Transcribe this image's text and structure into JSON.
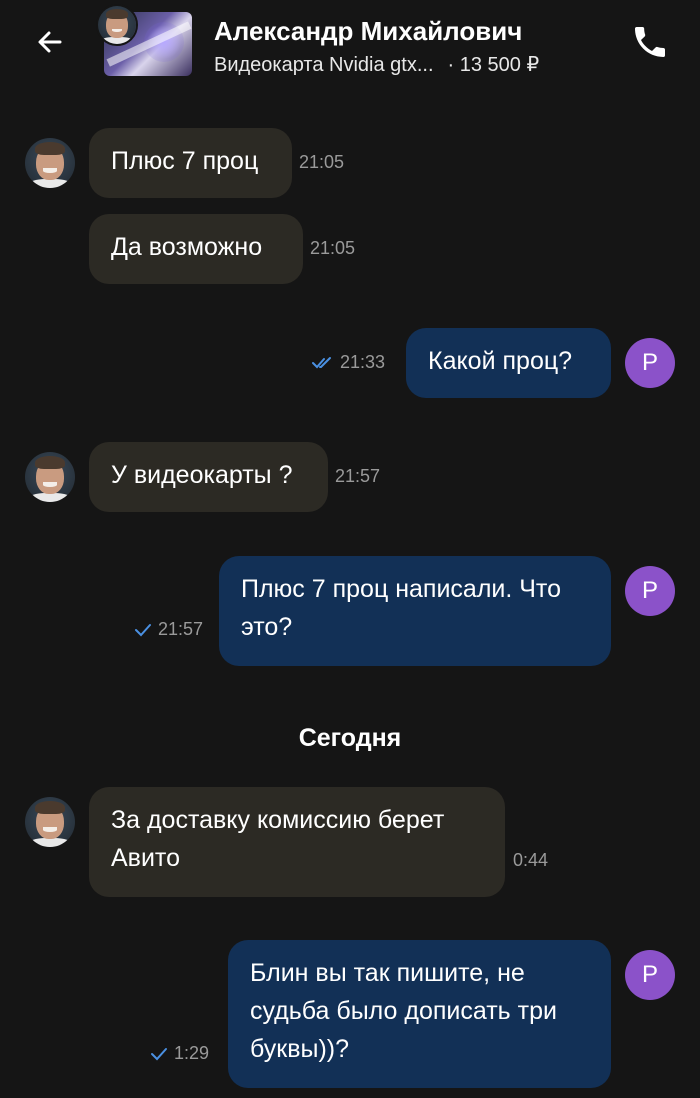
{
  "header": {
    "title": "Александр Михайлович",
    "ad_title": "Видеокарта Nvidia gtx...",
    "price": "· 13 500 ₽",
    "back_icon": "arrow-left-icon",
    "call_icon": "phone-icon"
  },
  "me": {
    "initial": "Р",
    "avatar_color": "#8b52c9"
  },
  "colors": {
    "background": "#151515",
    "incoming_bubble": "#2c2a24",
    "outgoing_bubble": "#123056",
    "read_check": "#4a90e2"
  },
  "messages": [
    {
      "direction": "in",
      "text": "Плюс 7 проц",
      "time": "21:05"
    },
    {
      "direction": "in",
      "text": "Да возможно",
      "time": "21:05"
    },
    {
      "direction": "out",
      "text": "Какой проц?",
      "time": "21:33",
      "status": "read"
    },
    {
      "direction": "in",
      "text": "У видеокарты ?",
      "time": "21:57"
    },
    {
      "direction": "out",
      "line1": "Плюс 7 проц написали. Что",
      "line2": "это?",
      "time": "21:57",
      "status": "sent"
    },
    {
      "direction": "in",
      "line1": "За доставку комиссию берет",
      "line2": "Авито",
      "time": "0:44"
    },
    {
      "direction": "out",
      "line1": "Блин вы так пишите, не",
      "line2": "судьба было дописать три",
      "line3": "буквы))?",
      "time": "1:29",
      "status": "sent"
    }
  ],
  "date_separator": "Сегодня"
}
